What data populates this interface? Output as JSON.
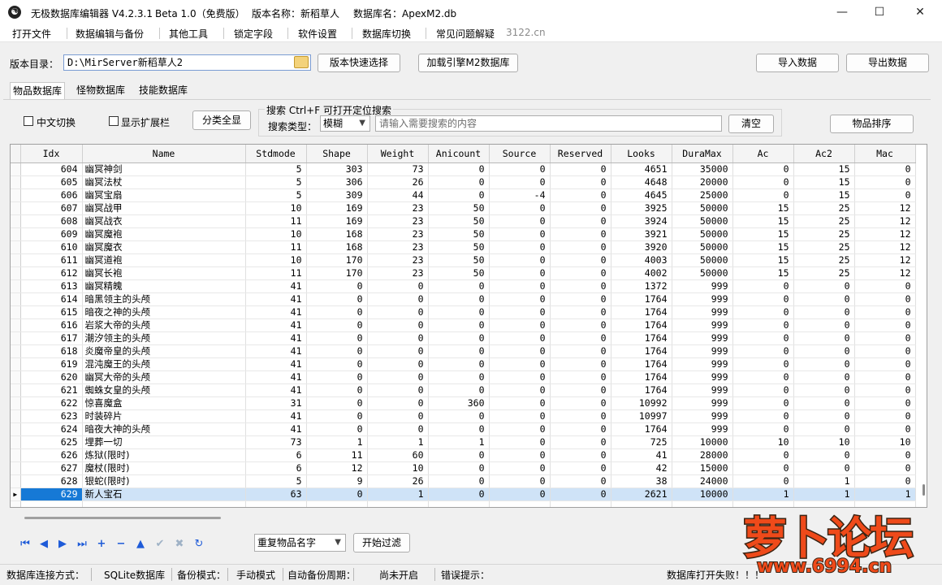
{
  "window": {
    "app_title": "无极数据库编辑器 V4.2.3.1",
    "edition": "Beta 1.0（免费版）",
    "version_label": "版本名称：新稻草人",
    "db_label": "数据库名：ApexM2.db",
    "minimize": "—",
    "maximize": "☐",
    "close": "✕"
  },
  "menu": [
    "打开文件",
    "数据编辑与备份",
    "其他工具",
    "锁定字段",
    "软件设置",
    "数据库切换",
    "常见问题解疑"
  ],
  "menu_extra": "3122.cn",
  "toolbar": {
    "dir_label": "版本目录：",
    "dir_value": "D:\\MirServer新稻草人2",
    "quick_select": "版本快速选择",
    "load_engine": "加载引擎M2数据库",
    "import": "导入数据",
    "export": "导出数据"
  },
  "tabs": [
    "物品数据库",
    "怪物数据库",
    "技能数据库"
  ],
  "panel": {
    "cn_switch": "中文切换",
    "show_ext": "显示扩展栏",
    "show_all": "分类全显",
    "search_title": "搜索   Ctrl+F 可打开定位搜索",
    "search_type_label": "搜索类型：",
    "search_type_value": "模糊",
    "search_placeholder": "请输入需要搜索的内容",
    "clear": "清空",
    "sort": "物品排序"
  },
  "grid": {
    "columns": [
      "Idx",
      "Name",
      "Stdmode",
      "Shape",
      "Weight",
      "Anicount",
      "Source",
      "Reserved",
      "Looks",
      "DuraMax",
      "Ac",
      "Ac2",
      "Mac"
    ],
    "rows": [
      [
        604,
        "幽冥神剑",
        5,
        303,
        73,
        0,
        0,
        0,
        4651,
        35000,
        0,
        15,
        0
      ],
      [
        605,
        "幽冥法杖",
        5,
        306,
        26,
        0,
        0,
        0,
        4648,
        20000,
        0,
        15,
        0
      ],
      [
        606,
        "幽冥宝扇",
        5,
        309,
        44,
        0,
        -4,
        0,
        4645,
        25000,
        0,
        15,
        0
      ],
      [
        607,
        "幽冥战甲",
        10,
        169,
        23,
        50,
        0,
        0,
        3925,
        50000,
        15,
        25,
        12
      ],
      [
        608,
        "幽冥战衣",
        11,
        169,
        23,
        50,
        0,
        0,
        3924,
        50000,
        15,
        25,
        12
      ],
      [
        609,
        "幽冥魔袍",
        10,
        168,
        23,
        50,
        0,
        0,
        3921,
        50000,
        15,
        25,
        12
      ],
      [
        610,
        "幽冥魔衣",
        11,
        168,
        23,
        50,
        0,
        0,
        3920,
        50000,
        15,
        25,
        12
      ],
      [
        611,
        "幽冥道袍",
        10,
        170,
        23,
        50,
        0,
        0,
        4003,
        50000,
        15,
        25,
        12
      ],
      [
        612,
        "幽冥长袍",
        11,
        170,
        23,
        50,
        0,
        0,
        4002,
        50000,
        15,
        25,
        12
      ],
      [
        613,
        "幽冥精魄",
        41,
        0,
        0,
        0,
        0,
        0,
        1372,
        999,
        0,
        0,
        0
      ],
      [
        614,
        "暗黑领主的头颅",
        41,
        0,
        0,
        0,
        0,
        0,
        1764,
        999,
        0,
        0,
        0
      ],
      [
        615,
        "暗夜之神的头颅",
        41,
        0,
        0,
        0,
        0,
        0,
        1764,
        999,
        0,
        0,
        0
      ],
      [
        616,
        "岩浆大帝的头颅",
        41,
        0,
        0,
        0,
        0,
        0,
        1764,
        999,
        0,
        0,
        0
      ],
      [
        617,
        "潮汐领主的头颅",
        41,
        0,
        0,
        0,
        0,
        0,
        1764,
        999,
        0,
        0,
        0
      ],
      [
        618,
        "炎魔帝皇的头颅",
        41,
        0,
        0,
        0,
        0,
        0,
        1764,
        999,
        0,
        0,
        0
      ],
      [
        619,
        "混沌魔王的头颅",
        41,
        0,
        0,
        0,
        0,
        0,
        1764,
        999,
        0,
        0,
        0
      ],
      [
        620,
        "幽冥大帝的头颅",
        41,
        0,
        0,
        0,
        0,
        0,
        1764,
        999,
        0,
        0,
        0
      ],
      [
        621,
        "蜘蛛女皇的头颅",
        41,
        0,
        0,
        0,
        0,
        0,
        1764,
        999,
        0,
        0,
        0
      ],
      [
        622,
        "惊喜魔盒",
        31,
        0,
        0,
        360,
        0,
        0,
        10992,
        999,
        0,
        0,
        0
      ],
      [
        623,
        "时装碎片",
        41,
        0,
        0,
        0,
        0,
        0,
        10997,
        999,
        0,
        0,
        0
      ],
      [
        624,
        "暗夜大神的头颅",
        41,
        0,
        0,
        0,
        0,
        0,
        1764,
        999,
        0,
        0,
        0
      ],
      [
        625,
        "埋葬一切",
        73,
        1,
        1,
        1,
        0,
        0,
        725,
        10000,
        10,
        10,
        10
      ],
      [
        626,
        "炼狱(限时)",
        6,
        11,
        60,
        0,
        0,
        0,
        41,
        28000,
        0,
        0,
        0
      ],
      [
        627,
        "魔杖(限时)",
        6,
        12,
        10,
        0,
        0,
        0,
        42,
        15000,
        0,
        0,
        0
      ],
      [
        628,
        "银蛇(限时)",
        5,
        9,
        26,
        0,
        0,
        0,
        38,
        24000,
        0,
        1,
        0
      ],
      [
        629,
        "新人宝石",
        63,
        0,
        1,
        0,
        0,
        0,
        2621,
        10000,
        1,
        1,
        1
      ]
    ],
    "selected_idx": 629
  },
  "nav": {
    "icons": [
      "first-icon",
      "prev-icon",
      "next-icon",
      "last-icon",
      "add-icon",
      "remove-icon",
      "up-icon",
      "check-icon",
      "cancel-icon",
      "refresh-icon"
    ],
    "filter_value": "重复物品名字",
    "filter_button": "开始过滤"
  },
  "status": {
    "conn_label": "数据库连接方式：",
    "conn_value": "SQLite数据库",
    "backup_label": "备份模式：",
    "backup_value": "手动模式",
    "auto_label": "自动备份周期：",
    "auto_value": "尚未开启",
    "error_label": "错误提示：",
    "error_value": "数据库打开失败！！！"
  },
  "watermark": {
    "main": "萝卜论坛",
    "url": "www.6994.cn"
  },
  "colors": {
    "selection": "#cfe3f7",
    "selected_index": "#1679d6",
    "nav_icon": "#1e5bd8",
    "watermark": "#ef4a1a"
  }
}
